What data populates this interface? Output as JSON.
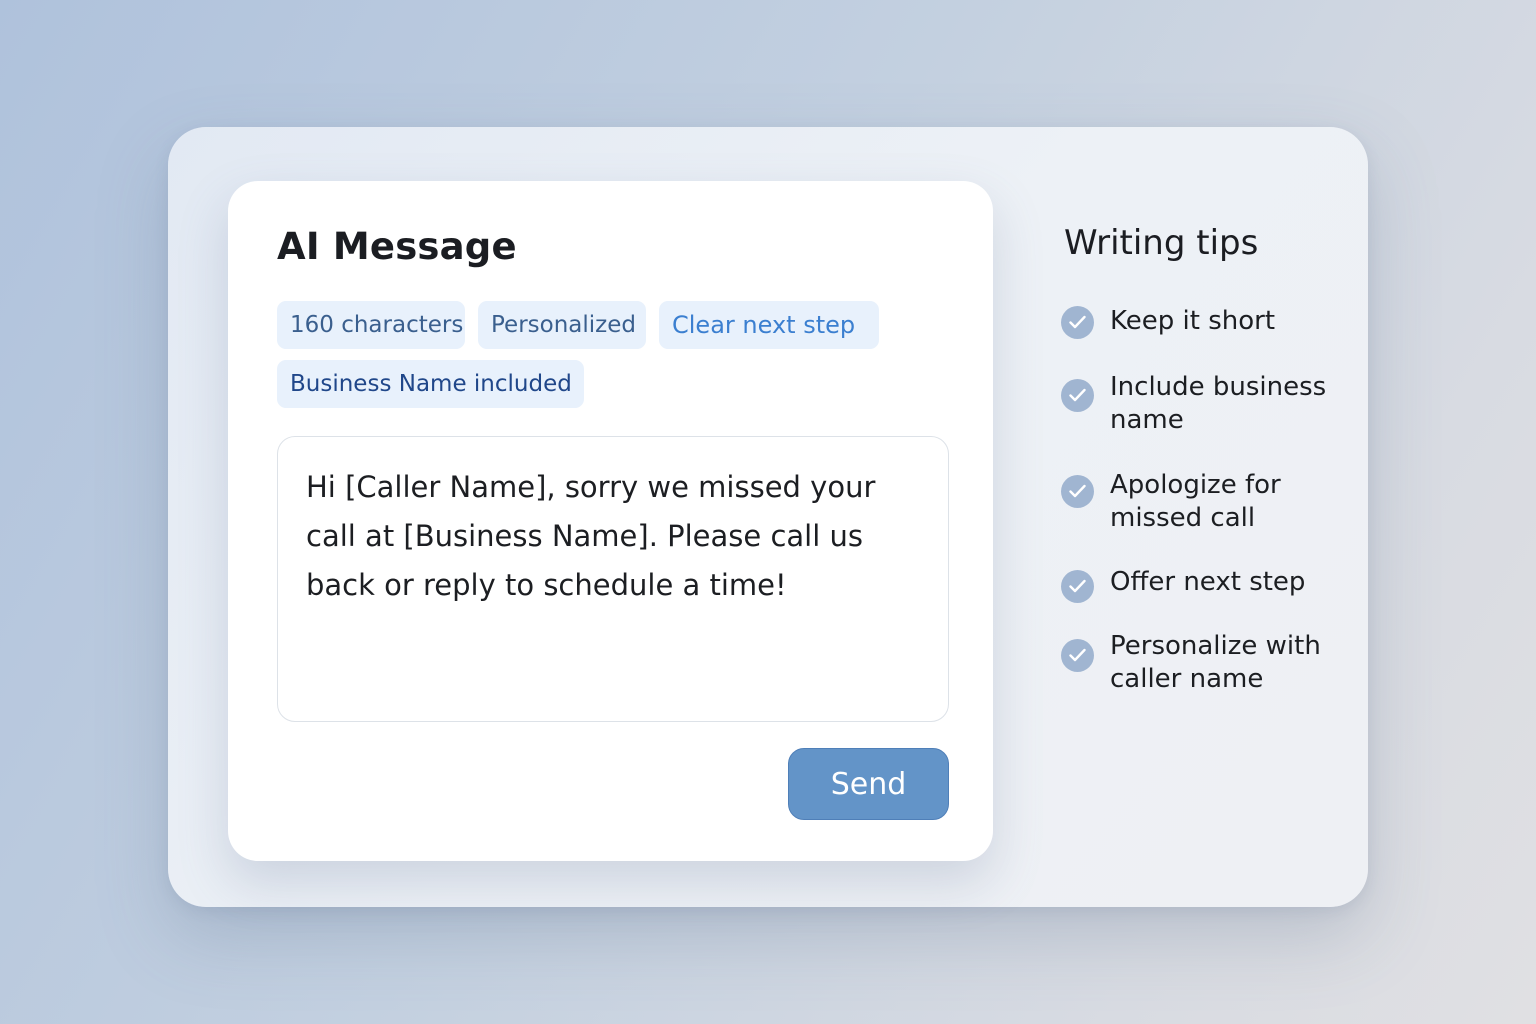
{
  "composer": {
    "title": "AI Message",
    "chips": [
      "160 characters",
      "Personalized",
      "Clear next step",
      "Business Name included"
    ],
    "message": "Hi [Caller Name], sorry we missed your call at [Business Name]. Please call us back or reply to schedule a time!",
    "send_label": "Send"
  },
  "tips": {
    "title": "Writing tips",
    "items": [
      {
        "text": "Keep it short"
      },
      {
        "text": "Include business name"
      },
      {
        "text": "Apologize for missed call"
      },
      {
        "text": "Offer next step"
      },
      {
        "text": "Personalize with caller name"
      }
    ]
  },
  "colors": {
    "accent": "#6394c8",
    "chip_background": "#e8f1fc",
    "check_icon": "#a0b5d1"
  },
  "icons": {
    "tip_marker": "check-circle-icon"
  }
}
